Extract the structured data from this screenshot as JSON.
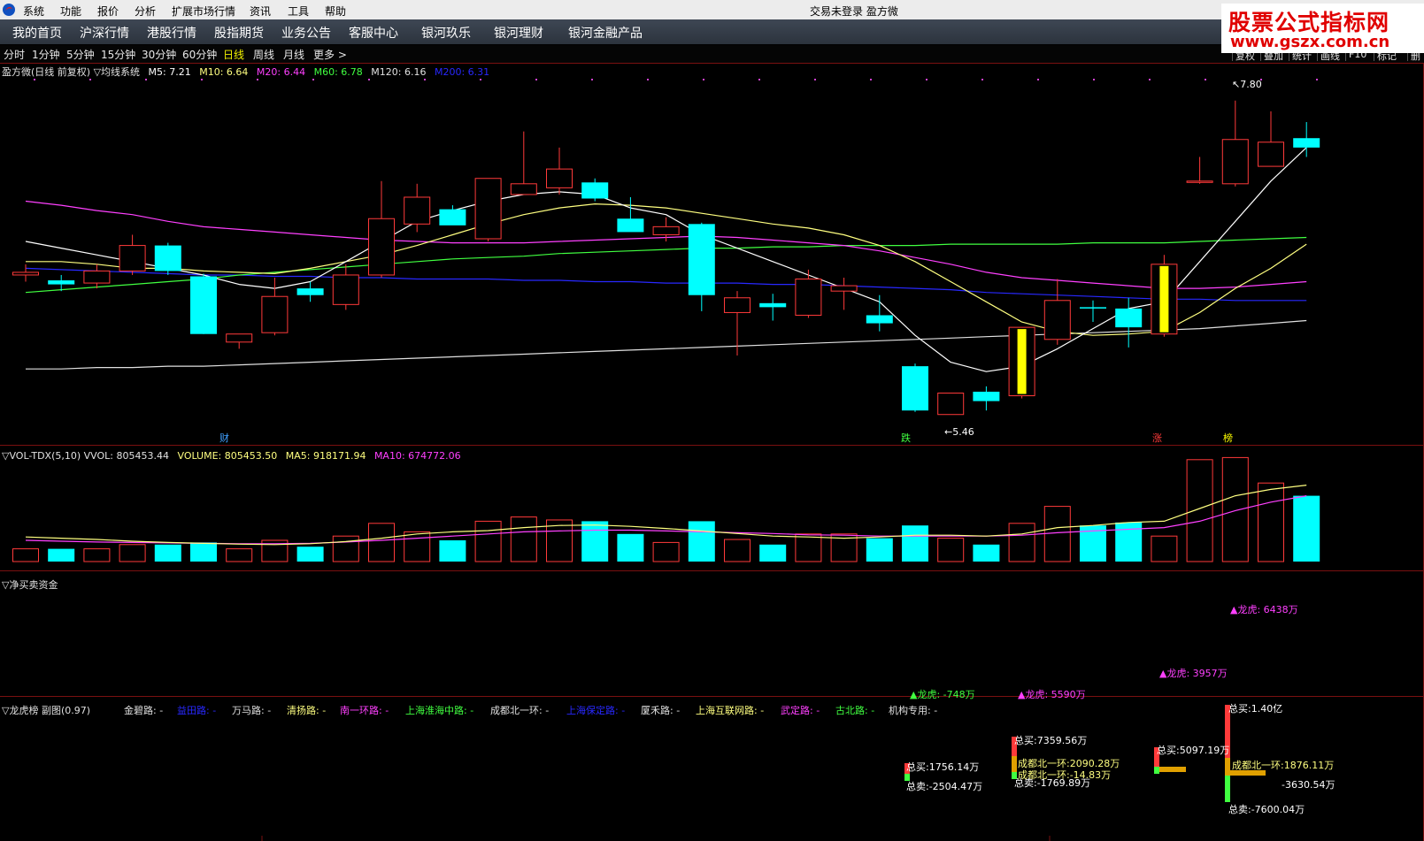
{
  "menu": {
    "items": [
      "系统",
      "功能",
      "报价",
      "分析",
      "扩展市场行情",
      "资讯",
      "工具",
      "帮助"
    ],
    "status": "交易未登录  盈方微"
  },
  "watermark": {
    "line1": "股票公式指标网",
    "line2": "www.gszx.com.cn"
  },
  "nav": {
    "items": [
      "我的首页",
      "沪深行情",
      "港股行情",
      "股指期货",
      "业务公告",
      "客服中心",
      "银河玖乐",
      "银河理财",
      "银河金融产品"
    ]
  },
  "periods": {
    "items": [
      "分时",
      "1分钟",
      "5分钟",
      "15分钟",
      "30分钟",
      "60分钟",
      "日线",
      "周线",
      "月线",
      "更多 >"
    ],
    "active_index": 6
  },
  "right_buttons": [
    "复权",
    "叠加",
    "统计",
    "画线",
    "F10",
    "标记",
    "删"
  ],
  "colors": {
    "up": "#ff3a3a",
    "down": "#00ffff",
    "ma5": "#ffffff",
    "ma10": "#ffff80",
    "ma20": "#ff40ff",
    "ma60": "#40ff40",
    "ma120": "#e0e0e0",
    "ma200": "#2828ff"
  },
  "main_panel": {
    "title": "盈方微(日线 前复权) ▽均线系统",
    "indicators": [
      {
        "label": "M5: 7.21",
        "color": "#ffffff"
      },
      {
        "label": "M10: 6.64",
        "color": "#ffff80"
      },
      {
        "label": "M20: 6.44",
        "color": "#ff40ff"
      },
      {
        "label": "M60: 6.78",
        "color": "#40ff40"
      },
      {
        "label": "M120: 6.16",
        "color": "#e0e0e0"
      },
      {
        "label": "M200: 6.31",
        "color": "#2828ff"
      }
    ],
    "high_marker": "7.80",
    "low_marker": "5.46",
    "events": [
      {
        "label": "财",
        "color": "#40a0ff",
        "x": 248
      },
      {
        "label": "跌",
        "color": "#40ff40",
        "x": 998
      },
      {
        "label": "涨",
        "color": "#ff3a3a",
        "x": 1274
      },
      {
        "label": "榜",
        "color": "#ffff00",
        "x": 1354
      }
    ]
  },
  "vol_panel": {
    "title": "▽VOL-TDX(5,10) VVOL: 805453.44",
    "indicators": [
      {
        "label": "VOLUME: 805453.50",
        "color": "#ffff80"
      },
      {
        "label": "MA5: 918171.94",
        "color": "#ffff80"
      },
      {
        "label": "MA10: 674772.06",
        "color": "#ff40ff"
      }
    ]
  },
  "fund_panel": {
    "title": "▽净买卖资金",
    "labels": [
      {
        "text": "▲龙虎: 6438万",
        "color": "#ff40ff"
      },
      {
        "text": "▲龙虎: 3957万",
        "color": "#ff40ff"
      },
      {
        "text": "▲龙虎: -748万",
        "color": "#40ff40"
      },
      {
        "text": "▲龙虎: 5590万",
        "color": "#ff40ff"
      }
    ]
  },
  "lhb_panel": {
    "title": "▽龙虎榜 副图(0.97)",
    "branches": [
      {
        "text": "金碧路: -",
        "color": "#e0e0e0"
      },
      {
        "text": "益田路: -",
        "color": "#2828ff"
      },
      {
        "text": "万马路: -",
        "color": "#e0e0e0"
      },
      {
        "text": "清扬路: -",
        "color": "#ffff80"
      },
      {
        "text": "南一环路: -",
        "color": "#ff40ff"
      },
      {
        "text": "上海淮海中路: -",
        "color": "#40ff40"
      },
      {
        "text": "成都北一环: -",
        "color": "#e0e0e0"
      },
      {
        "text": "上海保定路: -",
        "color": "#2828ff"
      },
      {
        "text": "厦禾路: -",
        "color": "#e0e0e0"
      },
      {
        "text": "上海互联网路: -",
        "color": "#ffff80"
      },
      {
        "text": "武定路: -",
        "color": "#ff40ff"
      },
      {
        "text": "古北路: -",
        "color": "#40ff40"
      },
      {
        "text": "机构专用: -",
        "color": "#e0e0e0"
      }
    ],
    "annotations": [
      {
        "text": "总买:1756.14万",
        "color": "#ffffff"
      },
      {
        "text": "总卖:-2504.47万",
        "color": "#ffffff"
      },
      {
        "text": "总买:7359.56万",
        "color": "#ffffff"
      },
      {
        "text": "成都北一环:2090.28万",
        "color": "#ffff80"
      },
      {
        "text": "成都北一环:-14.83万",
        "color": "#ffff80"
      },
      {
        "text": "总卖:-1769.89万",
        "color": "#ffffff"
      },
      {
        "text": "总买:5097.19万",
        "color": "#ffffff"
      },
      {
        "text": "总买:1.40亿",
        "color": "#ffffff"
      },
      {
        "text": "成都北一环:1876.11万",
        "color": "#ffff80"
      },
      {
        "text": "-3630.54万",
        "color": "#ffffff"
      },
      {
        "text": "总卖:-7600.04万",
        "color": "#ffffff"
      }
    ]
  },
  "chart_data": {
    "type": "candlestick",
    "title": "盈方微(日线 前复权)",
    "ylim": [
      5.3,
      7.95
    ],
    "candles": [
      {
        "o": 6.5,
        "h": 6.58,
        "l": 6.45,
        "c": 6.52
      },
      {
        "o": 6.46,
        "h": 6.5,
        "l": 6.38,
        "c": 6.43
      },
      {
        "o": 6.44,
        "h": 6.58,
        "l": 6.4,
        "c": 6.53
      },
      {
        "o": 6.53,
        "h": 6.8,
        "l": 6.5,
        "c": 6.72
      },
      {
        "o": 6.72,
        "h": 6.74,
        "l": 6.5,
        "c": 6.53
      },
      {
        "o": 6.49,
        "h": 6.51,
        "l": 6.06,
        "c": 6.06
      },
      {
        "o": 6.0,
        "h": 6.06,
        "l": 5.95,
        "c": 6.06
      },
      {
        "o": 6.07,
        "h": 6.48,
        "l": 6.05,
        "c": 6.34
      },
      {
        "o": 6.4,
        "h": 6.45,
        "l": 6.3,
        "c": 6.35
      },
      {
        "o": 6.28,
        "h": 6.58,
        "l": 6.24,
        "c": 6.5
      },
      {
        "o": 6.5,
        "h": 7.2,
        "l": 6.48,
        "c": 6.92
      },
      {
        "o": 6.88,
        "h": 7.18,
        "l": 6.82,
        "c": 7.08
      },
      {
        "o": 6.99,
        "h": 7.02,
        "l": 6.88,
        "c": 6.87
      },
      {
        "o": 6.77,
        "h": 7.22,
        "l": 6.75,
        "c": 7.22
      },
      {
        "o": 7.1,
        "h": 7.57,
        "l": 7.1,
        "c": 7.18
      },
      {
        "o": 7.15,
        "h": 7.45,
        "l": 7.1,
        "c": 7.29
      },
      {
        "o": 7.19,
        "h": 7.22,
        "l": 7.05,
        "c": 7.07
      },
      {
        "o": 6.92,
        "h": 7.08,
        "l": 6.85,
        "c": 6.82
      },
      {
        "o": 6.8,
        "h": 6.93,
        "l": 6.75,
        "c": 6.86
      },
      {
        "o": 6.88,
        "h": 6.89,
        "l": 6.23,
        "c": 6.35
      },
      {
        "o": 6.22,
        "h": 6.38,
        "l": 5.9,
        "c": 6.33
      },
      {
        "o": 6.29,
        "h": 6.36,
        "l": 6.16,
        "c": 6.26
      },
      {
        "o": 6.2,
        "h": 6.54,
        "l": 6.18,
        "c": 6.47
      },
      {
        "o": 6.38,
        "h": 6.48,
        "l": 6.24,
        "c": 6.42
      },
      {
        "o": 6.2,
        "h": 6.35,
        "l": 6.08,
        "c": 6.14
      },
      {
        "o": 5.82,
        "h": 5.84,
        "l": 5.48,
        "c": 5.49
      },
      {
        "o": 5.46,
        "h": 5.62,
        "l": 5.46,
        "c": 5.62
      },
      {
        "o": 5.63,
        "h": 5.67,
        "l": 5.49,
        "c": 5.56
      },
      {
        "o": 5.6,
        "h": 6.11,
        "l": 5.58,
        "c": 6.11
      },
      {
        "o": 6.02,
        "h": 6.47,
        "l": 5.98,
        "c": 6.31
      },
      {
        "o": 6.26,
        "h": 6.31,
        "l": 6.15,
        "c": 6.25
      },
      {
        "o": 6.25,
        "h": 6.33,
        "l": 5.96,
        "c": 6.11
      },
      {
        "o": 6.06,
        "h": 6.65,
        "l": 6.04,
        "c": 6.58
      },
      {
        "o": 7.2,
        "h": 7.38,
        "l": 7.18,
        "c": 7.2
      },
      {
        "o": 7.18,
        "h": 7.8,
        "l": 7.16,
        "c": 7.51
      },
      {
        "o": 7.31,
        "h": 7.72,
        "l": 7.31,
        "c": 7.49
      },
      {
        "o": 7.52,
        "h": 7.64,
        "l": 7.38,
        "c": 7.45
      }
    ],
    "ma_lines": {
      "ma5": [
        6.75,
        6.7,
        6.65,
        6.6,
        6.55,
        6.5,
        6.43,
        6.4,
        6.45,
        6.6,
        6.75,
        6.9,
        6.98,
        7.05,
        7.1,
        7.12,
        7.1,
        7.0,
        6.95,
        6.8,
        6.7,
        6.6,
        6.5,
        6.4,
        6.3,
        6.05,
        5.85,
        5.78,
        5.82,
        5.95,
        6.1,
        6.25,
        6.3,
        6.6,
        6.9,
        7.2,
        7.45
      ],
      "ma10": [
        6.6,
        6.6,
        6.58,
        6.55,
        6.55,
        6.53,
        6.52,
        6.51,
        6.55,
        6.6,
        6.65,
        6.72,
        6.8,
        6.88,
        6.95,
        7.0,
        7.03,
        7.02,
        7.0,
        6.96,
        6.92,
        6.88,
        6.85,
        6.8,
        6.72,
        6.6,
        6.45,
        6.3,
        6.15,
        6.08,
        6.05,
        6.06,
        6.08,
        6.22,
        6.4,
        6.55,
        6.73
      ],
      "ma20": [
        7.05,
        7.02,
        6.98,
        6.95,
        6.9,
        6.86,
        6.84,
        6.82,
        6.8,
        6.78,
        6.76,
        6.75,
        6.74,
        6.74,
        6.74,
        6.75,
        6.76,
        6.77,
        6.78,
        6.79,
        6.78,
        6.76,
        6.74,
        6.72,
        6.68,
        6.63,
        6.58,
        6.52,
        6.48,
        6.46,
        6.44,
        6.42,
        6.4,
        6.4,
        6.41,
        6.43,
        6.45
      ],
      "ma60": [
        6.37,
        6.39,
        6.41,
        6.43,
        6.45,
        6.47,
        6.5,
        6.52,
        6.54,
        6.56,
        6.58,
        6.6,
        6.62,
        6.63,
        6.64,
        6.66,
        6.67,
        6.68,
        6.69,
        6.7,
        6.7,
        6.71,
        6.71,
        6.72,
        6.72,
        6.72,
        6.73,
        6.73,
        6.73,
        6.73,
        6.74,
        6.74,
        6.74,
        6.75,
        6.76,
        6.77,
        6.78
      ],
      "ma120": [
        5.8,
        5.8,
        5.81,
        5.81,
        5.82,
        5.82,
        5.83,
        5.84,
        5.85,
        5.86,
        5.87,
        5.88,
        5.89,
        5.9,
        5.91,
        5.92,
        5.93,
        5.94,
        5.95,
        5.96,
        5.97,
        5.98,
        5.99,
        6.0,
        6.01,
        6.02,
        6.03,
        6.04,
        6.05,
        6.06,
        6.07,
        6.08,
        6.09,
        6.1,
        6.12,
        6.14,
        6.16
      ],
      "ma200": [
        6.55,
        6.54,
        6.53,
        6.52,
        6.51,
        6.5,
        6.5,
        6.49,
        6.49,
        6.48,
        6.48,
        6.47,
        6.47,
        6.47,
        6.46,
        6.46,
        6.45,
        6.45,
        6.44,
        6.44,
        6.44,
        6.43,
        6.43,
        6.42,
        6.41,
        6.4,
        6.39,
        6.37,
        6.36,
        6.35,
        6.34,
        6.33,
        6.32,
        6.32,
        6.31,
        6.31,
        6.31
      ]
    },
    "volume": [
      0.3,
      0.3,
      0.3,
      0.4,
      0.4,
      0.45,
      0.3,
      0.5,
      0.35,
      0.6,
      0.9,
      0.7,
      0.5,
      0.95,
      1.05,
      0.98,
      0.95,
      0.65,
      0.45,
      0.95,
      0.52,
      0.4,
      0.65,
      0.65,
      0.55,
      0.85,
      0.55,
      0.4,
      0.9,
      1.3,
      0.85,
      0.92,
      0.6,
      2.4,
      2.45,
      1.85,
      1.55
    ],
    "vol_ma5": [
      0.58,
      0.55,
      0.52,
      0.48,
      0.45,
      0.43,
      0.41,
      0.4,
      0.42,
      0.47,
      0.55,
      0.65,
      0.7,
      0.73,
      0.8,
      0.85,
      0.86,
      0.83,
      0.78,
      0.72,
      0.66,
      0.6,
      0.58,
      0.55,
      0.58,
      0.62,
      0.62,
      0.6,
      0.65,
      0.8,
      0.85,
      0.92,
      0.95,
      1.25,
      1.55,
      1.7,
      1.8
    ],
    "vol_ma10": [
      0.5,
      0.48,
      0.46,
      0.45,
      0.44,
      0.43,
      0.42,
      0.42,
      0.43,
      0.46,
      0.5,
      0.55,
      0.6,
      0.65,
      0.7,
      0.72,
      0.74,
      0.74,
      0.72,
      0.7,
      0.68,
      0.66,
      0.63,
      0.62,
      0.6,
      0.6,
      0.6,
      0.6,
      0.62,
      0.68,
      0.72,
      0.76,
      0.8,
      0.95,
      1.2,
      1.4,
      1.55
    ],
    "vol_ylim": [
      0,
      2.5
    ]
  }
}
